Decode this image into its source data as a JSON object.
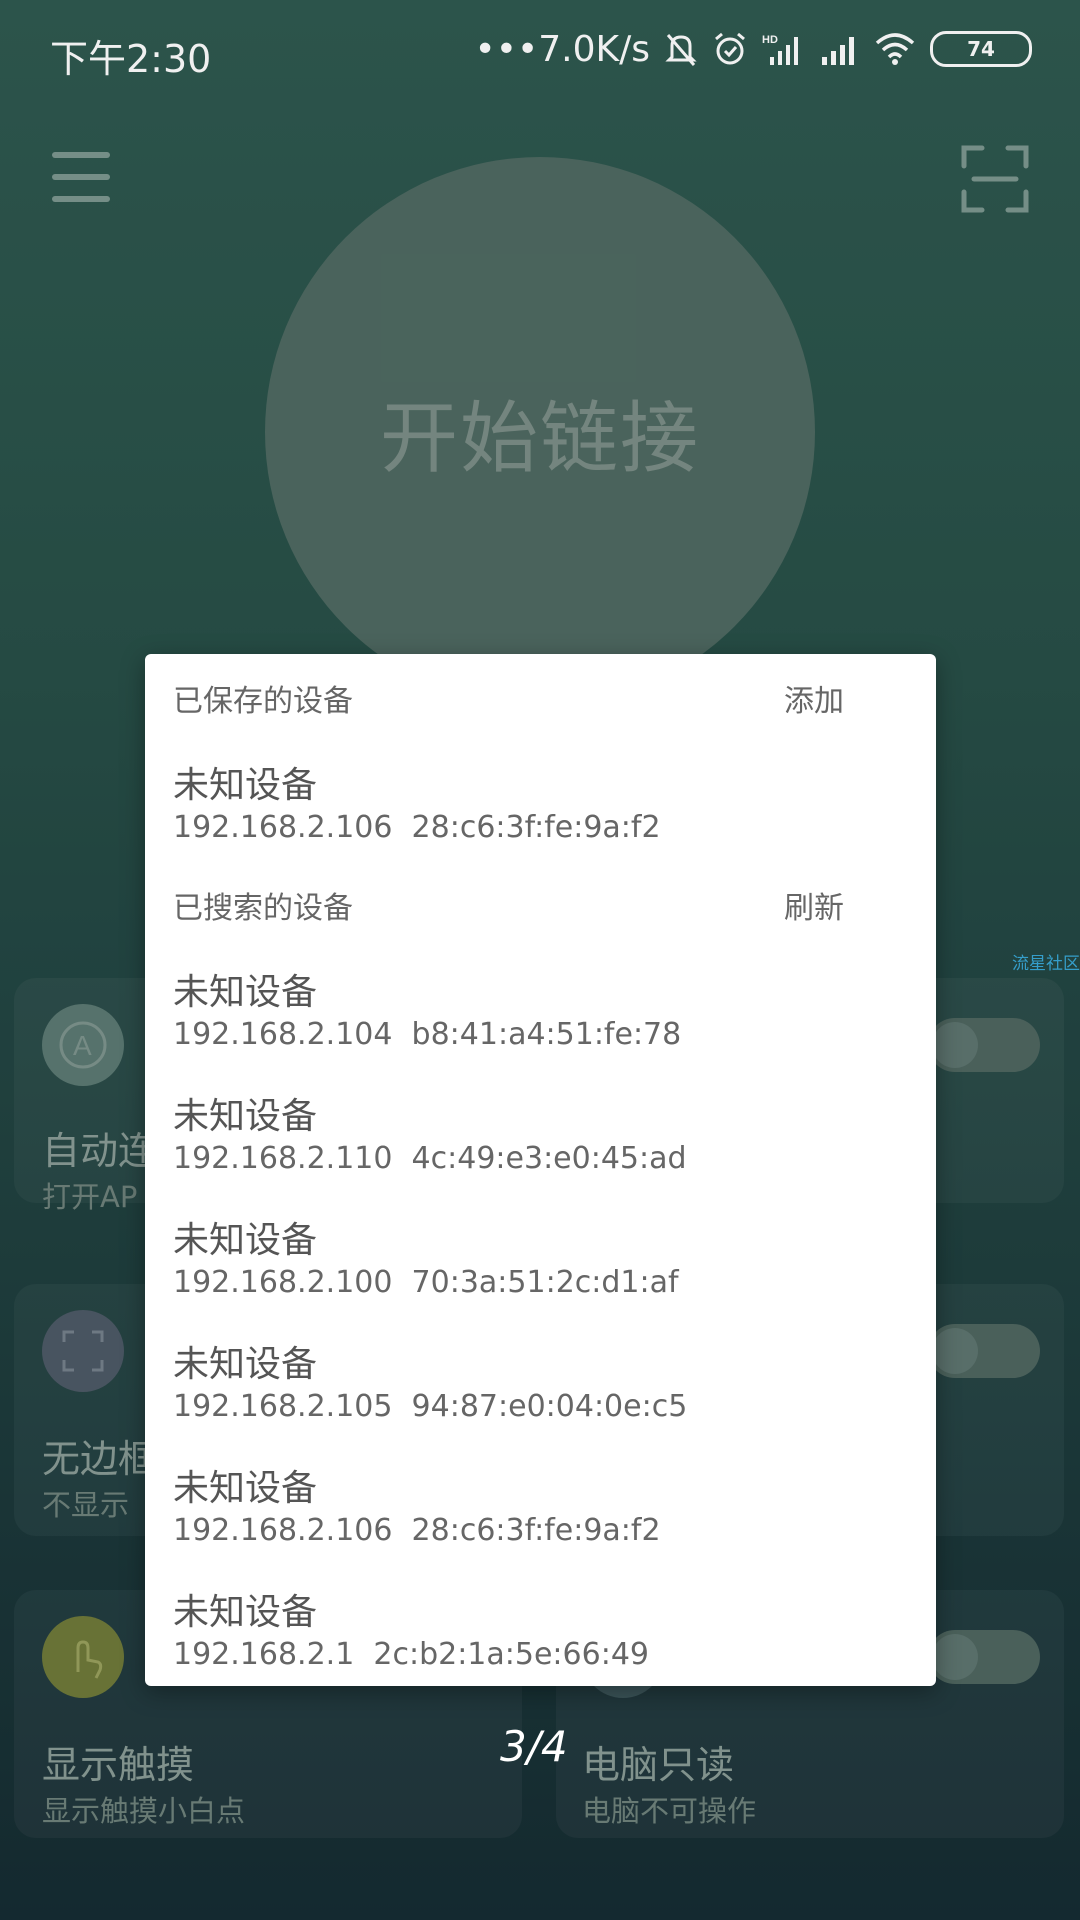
{
  "status_bar": {
    "time": "下午2:30",
    "net_speed": "•••7.0K/s",
    "battery": "74",
    "icons": [
      "mute-icon",
      "alarm-icon",
      "hd-signal-icon",
      "signal-icon",
      "wifi-icon",
      "battery-icon"
    ]
  },
  "header": {
    "menu_icon": "menu-icon",
    "scan_icon": "scan-icon"
  },
  "connect": {
    "label": "开始链接"
  },
  "cards": [
    {
      "title": "自动连",
      "subtitle": "打开AP",
      "icon": "auto-connect-icon"
    },
    {
      "title": "无边框",
      "subtitle": "不显示",
      "icon": "borderless-icon"
    },
    {
      "title": "显示触摸",
      "subtitle": "显示触摸小白点",
      "icon": "touch-icon"
    },
    {
      "title": "电脑只读",
      "subtitle": "电脑不可操作",
      "icon": "readonly-icon"
    }
  ],
  "watermark": "流星社区",
  "dialog": {
    "saved": {
      "title": "已保存的设备",
      "action": "添加",
      "devices": [
        {
          "name": "未知设备",
          "info": "192.168.2.106  28:c6:3f:fe:9a:f2"
        }
      ]
    },
    "searched": {
      "title": "已搜索的设备",
      "action": "刷新",
      "devices": [
        {
          "name": "未知设备",
          "info": "192.168.2.104  b8:41:a4:51:fe:78"
        },
        {
          "name": "未知设备",
          "info": "192.168.2.110  4c:49:e3:e0:45:ad"
        },
        {
          "name": "未知设备",
          "info": "192.168.2.100  70:3a:51:2c:d1:af"
        },
        {
          "name": "未知设备",
          "info": "192.168.2.105  94:87:e0:04:0e:c5"
        },
        {
          "name": "未知设备",
          "info": "192.168.2.106  28:c6:3f:fe:9a:f2"
        },
        {
          "name": "未知设备",
          "info": "192.168.2.1  2c:b2:1a:5e:66:49"
        }
      ]
    }
  },
  "page_indicator": "3/4"
}
